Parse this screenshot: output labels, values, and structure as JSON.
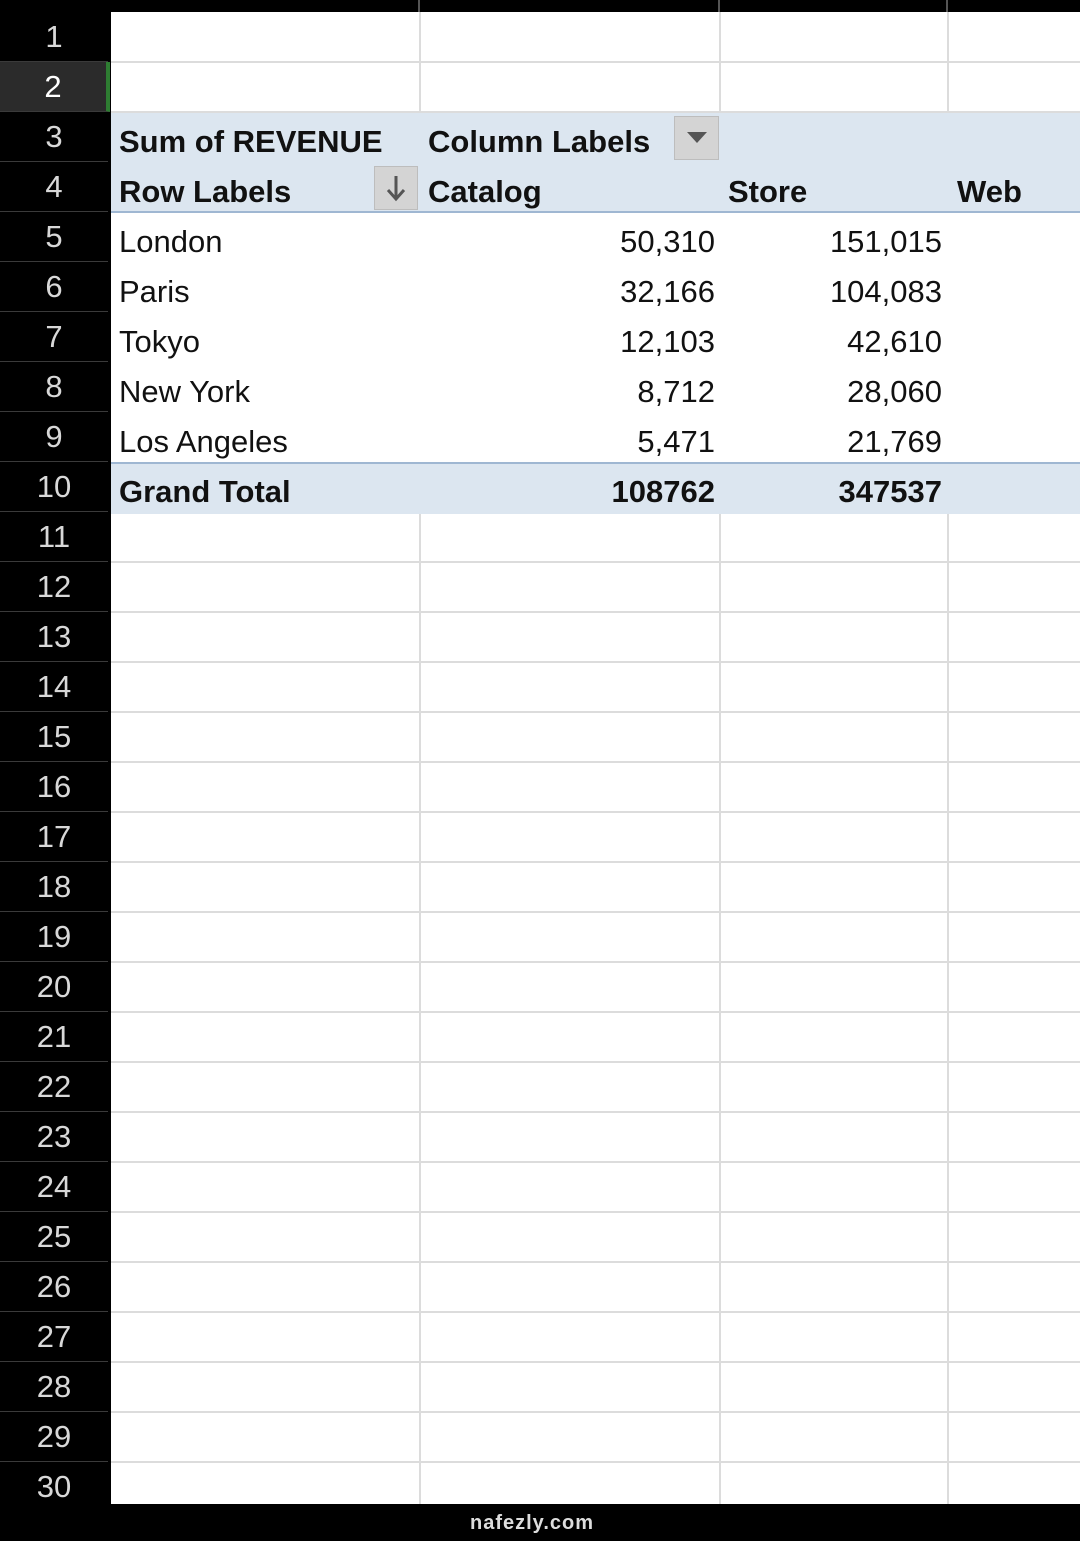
{
  "row_numbers": [
    "1",
    "2",
    "3",
    "4",
    "5",
    "6",
    "7",
    "8",
    "9",
    "10",
    "11",
    "12",
    "13",
    "14",
    "15",
    "16",
    "17",
    "18",
    "19",
    "20",
    "21",
    "22",
    "23",
    "24",
    "25",
    "26",
    "27",
    "28",
    "29",
    "30"
  ],
  "pivot": {
    "value_label": "Sum of REVENUE",
    "column_labels": "Column Labels",
    "row_labels": "Row Labels",
    "columns": [
      "Catalog",
      "Store",
      "Web"
    ],
    "rows": [
      {
        "label": "London",
        "catalog": "50,310",
        "store": "151,015"
      },
      {
        "label": "Paris",
        "catalog": "32,166",
        "store": "104,083"
      },
      {
        "label": "Tokyo",
        "catalog": "12,103",
        "store": "42,610"
      },
      {
        "label": "New York",
        "catalog": "8,712",
        "store": "28,060"
      },
      {
        "label": "Los Angeles",
        "catalog": "5,471",
        "store": "21,769"
      }
    ],
    "grand_total": {
      "label": "Grand Total",
      "catalog": "108762",
      "store": "347537"
    }
  },
  "watermark": "nafezly.com",
  "colors": {
    "pivot_band": "#dce6f0",
    "selected_row_accent": "#2e7d32"
  }
}
